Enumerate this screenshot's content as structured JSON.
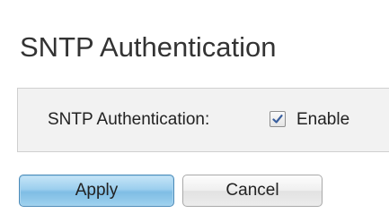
{
  "page": {
    "title": "SNTP Authentication"
  },
  "settings": {
    "sntp_authentication": {
      "label": "SNTP Authentication:",
      "checkbox_label": "Enable",
      "checked": true
    }
  },
  "actions": {
    "apply_label": "Apply",
    "cancel_label": "Cancel"
  },
  "colors": {
    "apply_button": "#9ccfee",
    "panel_background": "#f2f2f2",
    "checkmark": "#3a5f9e"
  }
}
